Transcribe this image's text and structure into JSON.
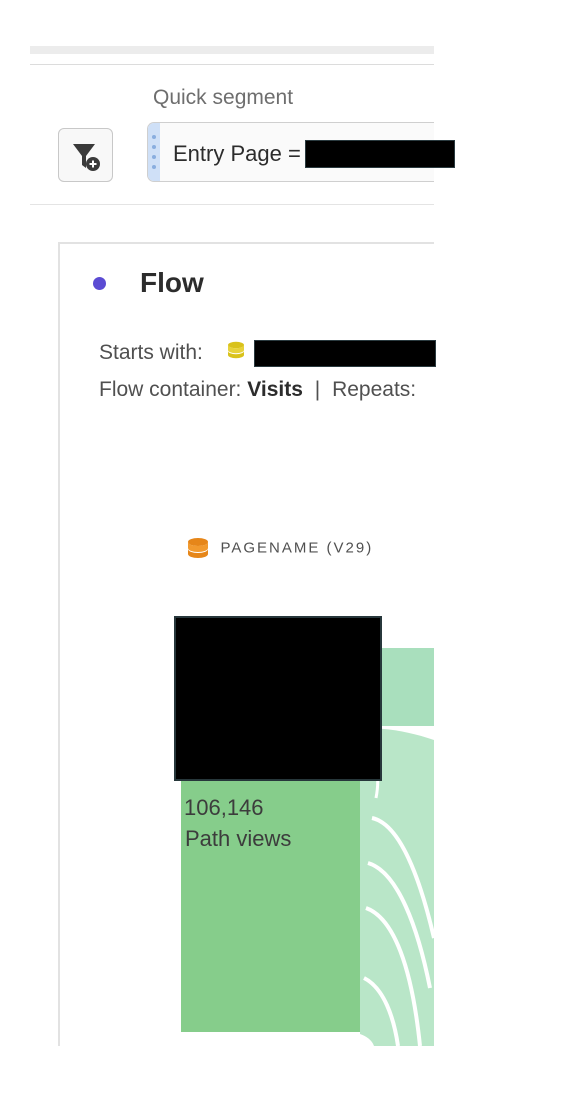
{
  "quick_segment": {
    "label": "Quick segment",
    "segment_text": "Entry Page ="
  },
  "panel": {
    "title": "Flow",
    "starts_with_label": "Starts with:",
    "flow_container_label": "Flow container:",
    "flow_container_value": "Visits",
    "separator": "|",
    "repeats_label": "Repeats:"
  },
  "dimension": {
    "name": "PAGENAME (V29)",
    "icon": "dimension-icon"
  },
  "flow_node": {
    "value": "106,146",
    "metric_label": "Path views"
  },
  "colors": {
    "panel_dot": "#5b4bd3",
    "node": "#86cd8b",
    "flow_band": "#a9dfbd",
    "dimension_icon": "#e68619",
    "dimension_icon_small": "#d9c21b"
  }
}
